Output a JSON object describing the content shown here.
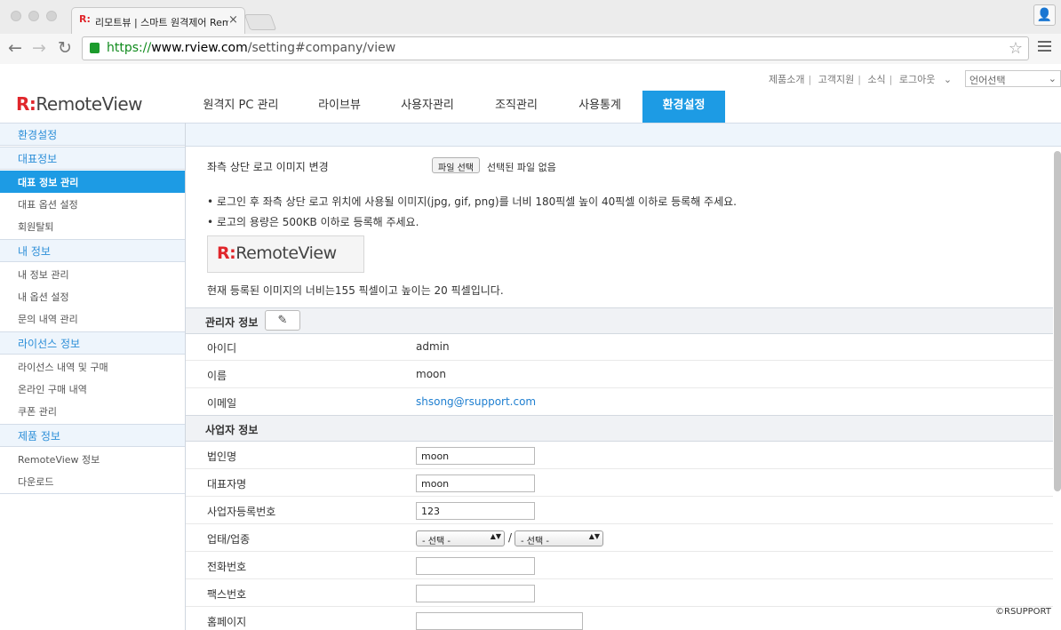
{
  "browser": {
    "tab_title": "리모트뷰 | 스마트 원격제어 Rem",
    "tab_close": "×",
    "url_scheme": "https://",
    "url_host": "www.rview.com",
    "url_path": "/setting#company/view",
    "star_icon": "☆",
    "profile_icon": "👤",
    "back_icon": "←",
    "forward_icon": "→",
    "reload_icon": "↻"
  },
  "header": {
    "logo_mark": "R:",
    "logo_text": "RemoteView",
    "top_links": [
      "제품소개",
      "고객지원",
      "소식",
      "로그아웃"
    ],
    "logout_arrow": "⌄",
    "language_select": "언어선택",
    "language_arrow": "⌄",
    "main_tabs": [
      {
        "label": "원격지 PC 관리"
      },
      {
        "label": "라이브뷰"
      },
      {
        "label": "사용자관리"
      },
      {
        "label": "조직관리"
      },
      {
        "label": "사용통계"
      },
      {
        "label": "환경설정"
      }
    ]
  },
  "sidebar": {
    "title": "환경설정",
    "groups": [
      {
        "title": "대표정보",
        "items": [
          "대표 정보 관리",
          "대표 옵션 설정",
          "회원탈퇴"
        ]
      },
      {
        "title": "내 정보",
        "items": [
          "내 정보 관리",
          "내 옵션 설정",
          "문의 내역 관리"
        ]
      },
      {
        "title": "라이선스 정보",
        "items": [
          "라이선스 내역 및 구매",
          "온라인 구매 내역",
          "쿠폰 관리"
        ]
      },
      {
        "title": "제품 정보",
        "items": [
          "RemoteView 정보",
          "다운로드"
        ]
      }
    ]
  },
  "logo_section": {
    "label": "좌측 상단 로고 이미지 변경",
    "file_button": "파일 선택",
    "file_status": "선택된 파일 없음",
    "notes": [
      "로그인 후 좌측 상단 로고 위치에 사용될 이미지(jpg, gif, png)를 너비 180픽셀 높이 40픽셀 이하로 등록해 주세요.",
      "로고의 용량은 500KB 이하로 등록해 주세요."
    ],
    "preview_mark": "R:",
    "preview_text": "RemoteView",
    "current_size_text": "현재 등록된 이미지의 너비는155 픽셀이고 높이는 20 픽셀입니다."
  },
  "admin_section": {
    "title": "관리자 정보",
    "edit_icon": "✎",
    "rows": [
      {
        "label": "아이디",
        "value": "admin"
      },
      {
        "label": "이름",
        "value": "moon"
      },
      {
        "label": "이메일",
        "value": "shsong@rsupport.com"
      }
    ]
  },
  "business_section": {
    "title": "사업자 정보",
    "corp_name_label": "법인명",
    "corp_name_value": "moon",
    "ceo_label": "대표자명",
    "ceo_value": "moon",
    "reg_label": "사업자등록번호",
    "reg_value": "123",
    "industry_label": "업태/업종",
    "industry_select_1": "- 선택 -",
    "industry_separator": "/",
    "industry_select_2": "- 선택 -",
    "select_arrow": "▲▼",
    "phone_label": "전화번호",
    "phone_value": "",
    "fax_label": "팩스번호",
    "fax_value": "",
    "homepage_label": "홈페이지",
    "homepage_value": ""
  },
  "footer": {
    "copyright": "©RSUPPORT"
  },
  "colors": {
    "accent": "#1d9be4",
    "brand_red": "#e0262b",
    "link": "#1f7fd0"
  }
}
